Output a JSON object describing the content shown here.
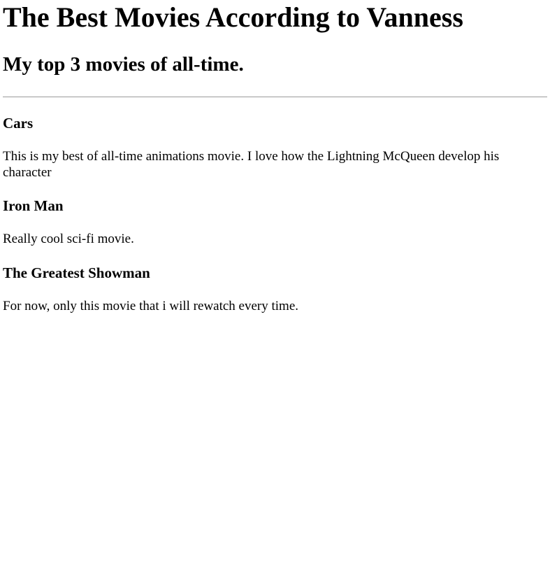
{
  "page": {
    "title": "The Best Movies According to Vanness",
    "subtitle": "My top 3 movies of all-time."
  },
  "movies": [
    {
      "name": "Cars",
      "description": "This is my best of all-time animations movie. I love how the Lightning McQueen develop his character"
    },
    {
      "name": "Iron Man",
      "description": "Really cool sci-fi movie."
    },
    {
      "name": "The Greatest Showman",
      "description": "For now, only this movie that i will rewatch every time."
    }
  ]
}
